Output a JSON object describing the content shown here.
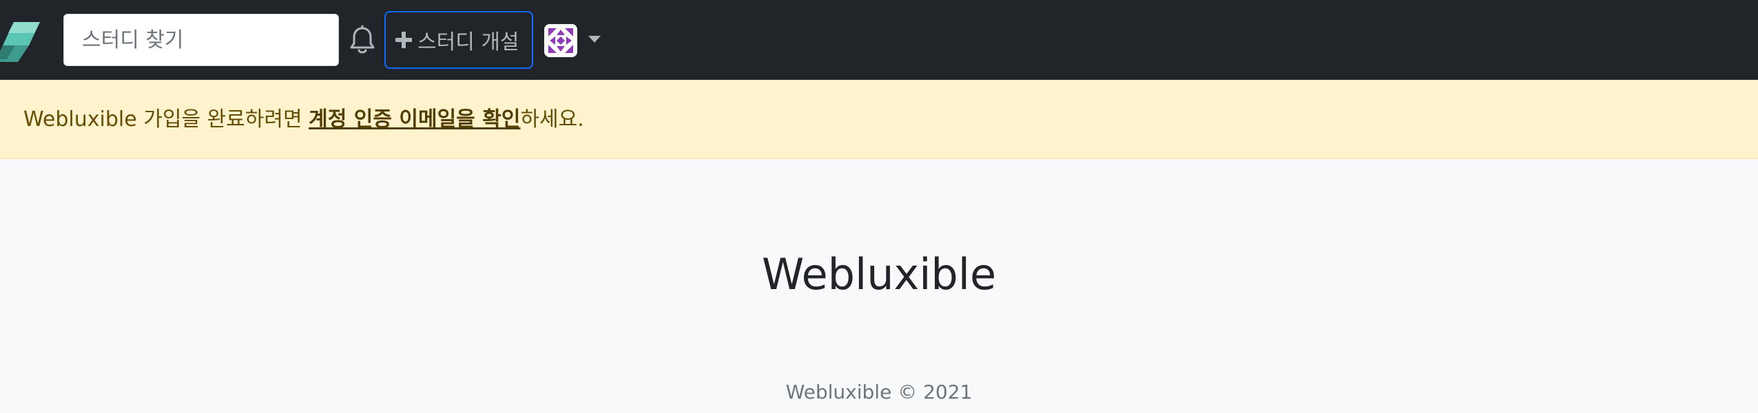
{
  "navbar": {
    "logo_icon": "brand-logo-icon",
    "search": {
      "placeholder": "스터디 찾기",
      "value": ""
    },
    "bell_icon": "bell-icon",
    "open_study_label": "스터디 개설",
    "open_study_icon": "plus-icon",
    "avatar_icon": "identicon-avatar",
    "caret_icon": "caret-down-icon"
  },
  "alert": {
    "before": "Webluxible 가입을 완료하려면 ",
    "link": "계정 인증 이메일을 확인",
    "after": "하세요."
  },
  "main": {
    "title": "Webluxible"
  },
  "footer": {
    "text": "Webluxible © 2021"
  },
  "colors": {
    "navbar_bg": "#212529",
    "page_bg": "#f8f9fa",
    "alert_bg": "#fff3cd",
    "alert_text": "#664d03",
    "button_border": "#0d6efd",
    "logo_teal": "#5cc5b4",
    "avatar_purple": "#8e3bb5"
  }
}
